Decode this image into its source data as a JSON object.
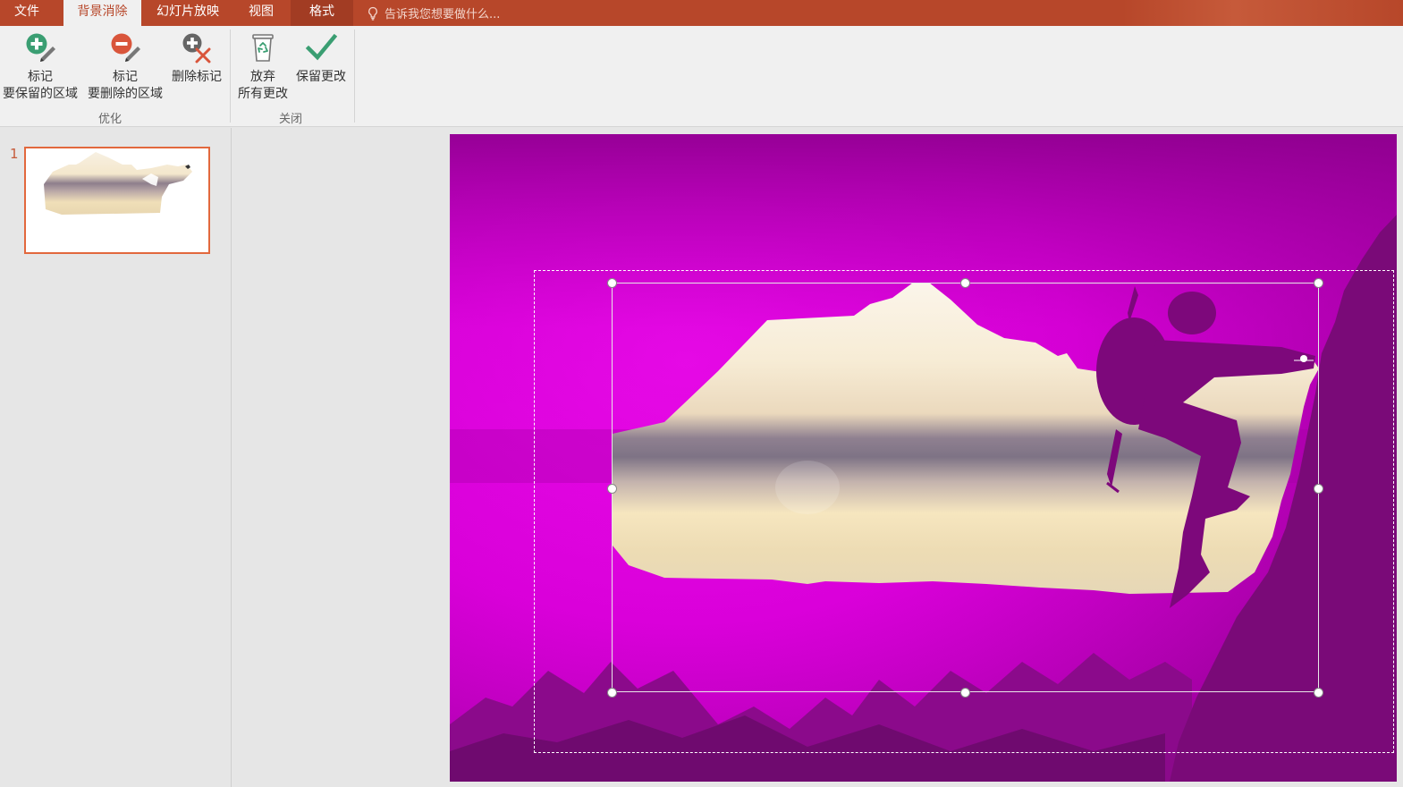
{
  "tabs": [
    {
      "label": "文件"
    },
    {
      "label": "背景消除"
    },
    {
      "label": "幻灯片放映"
    },
    {
      "label": "视图"
    },
    {
      "label": "格式"
    }
  ],
  "tell_me": {
    "placeholder": "告诉我您想要做什么..."
  },
  "ribbon": {
    "mark_keep": {
      "line1": "标记",
      "line2": "要保留的区域",
      "icon": "plus-pencil-icon",
      "color": "#3a9e72"
    },
    "mark_remove": {
      "line1": "标记",
      "line2": "要删除的区域",
      "icon": "minus-pencil-icon",
      "color": "#d9553b"
    },
    "delete_mark": {
      "line1": "删除标记",
      "icon": "delete-mark-icon"
    },
    "discard": {
      "line1": "放弃",
      "line2": "所有更改",
      "icon": "recycle-bin-icon"
    },
    "keep_changes": {
      "line1": "保留更改",
      "icon": "checkmark-icon",
      "color": "#3a9e72"
    },
    "group_refine": "优化",
    "group_close": "关闭"
  },
  "thumbnails": [
    {
      "number": "1"
    }
  ],
  "colors": {
    "accent": "#b7472a",
    "removal_overlay": "#e600e6",
    "thumb_border": "#e2683d"
  }
}
